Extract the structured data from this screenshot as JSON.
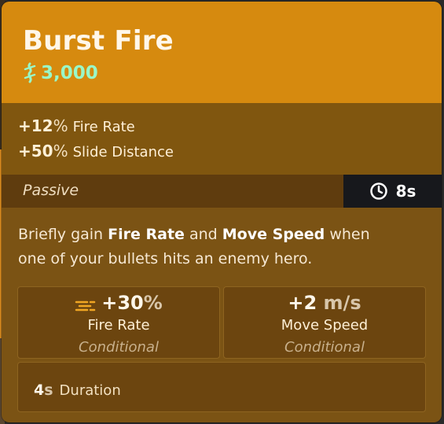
{
  "item": {
    "title": "Burst Fire",
    "price": "3,000",
    "price_icon": "soul-currency-icon",
    "colors": {
      "header": "#d68a0f",
      "price": "#9af7c7",
      "body": "#7b5314",
      "passive_bar": "#5f3c0e",
      "cooldown_bg": "#17181c"
    }
  },
  "stats": [
    {
      "value": "+12",
      "unit": "%",
      "label": "Fire Rate"
    },
    {
      "value": "+50",
      "unit": "%",
      "label": "Slide Distance"
    }
  ],
  "passive": {
    "label": "Passive",
    "cooldown": "8s",
    "cooldown_icon": "cooldown-clock-icon"
  },
  "description": {
    "part1": "Briefly gain ",
    "bold1": "Fire Rate",
    "part2": " and ",
    "bold2": "Move Speed",
    "part3": " when",
    "line2": "one of your bullets hits an enemy hero."
  },
  "effects": [
    {
      "value": "+30",
      "unit": "%",
      "label": "Fire Rate",
      "condition": "Conditional",
      "icon": "fire-rate-icon"
    },
    {
      "value": "+2",
      "unit": "m/s",
      "label": "Move Speed",
      "condition": "Conditional"
    }
  ],
  "duration": {
    "value": "4",
    "unit": "s",
    "label": "Duration"
  }
}
